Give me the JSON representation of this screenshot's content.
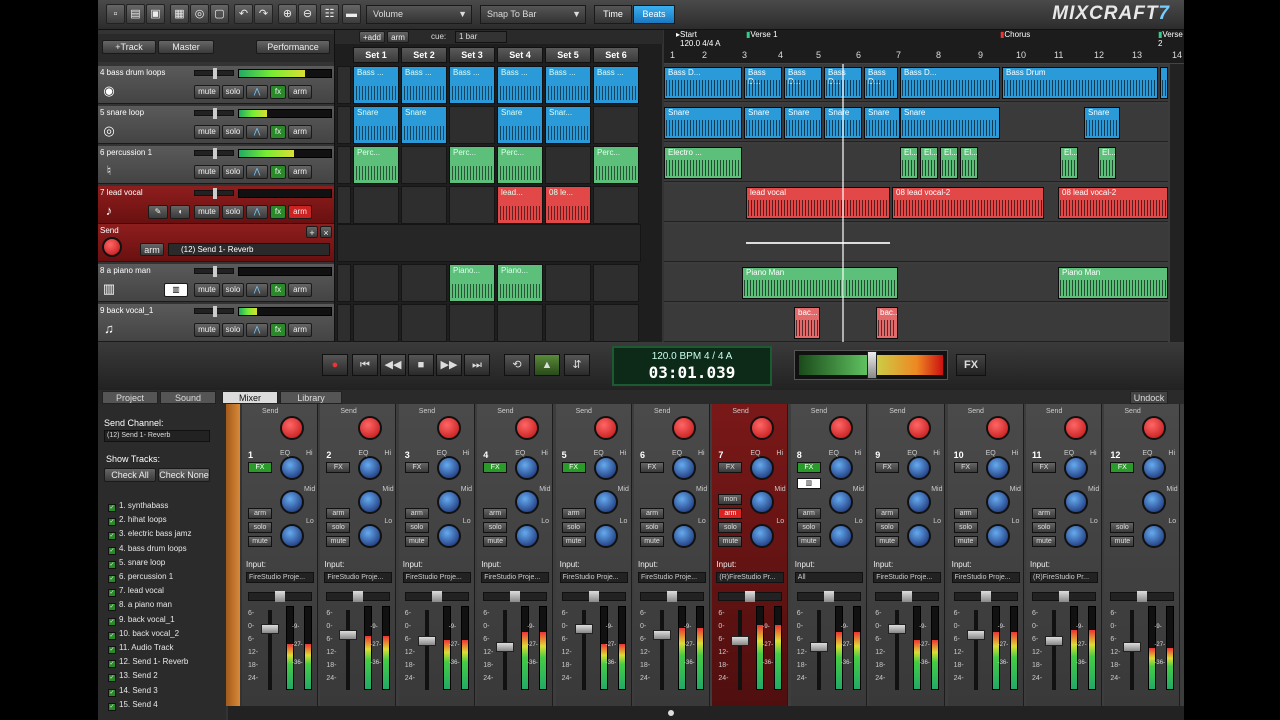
{
  "app": {
    "logo_prefix": "MIXCRAFT",
    "logo_version": "7"
  },
  "toolbar": {
    "volume_dropdown": "Volume",
    "snap_dropdown": "Snap To Bar",
    "time_label": "Time",
    "beats_label": "Beats"
  },
  "track_header": {
    "add_track": "+Track",
    "master": "Master",
    "performance": "Performance"
  },
  "tracks": [
    {
      "name": "4 bass drum loops",
      "icon": "drum-icon",
      "level": 0.72
    },
    {
      "name": "5 snare loop",
      "icon": "snare-icon",
      "level": 0.3
    },
    {
      "name": "6 percussion 1",
      "icon": "percussion-icon",
      "level": 0.6
    },
    {
      "name": "7 lead vocal",
      "icon": "microphone-icon",
      "level": 0.0
    },
    {
      "name": "8 a piano man",
      "icon": "piano-icon",
      "level": 0.0
    },
    {
      "name": "9 back vocal_1",
      "icon": "singer-icon",
      "level": 0.2
    }
  ],
  "track_buttons": {
    "mute": "mute",
    "solo": "solo",
    "fx": "fx",
    "arm": "arm"
  },
  "send": {
    "label": "Send",
    "arm": "arm",
    "channel": "(12) Send 1- Reverb"
  },
  "launcher": {
    "add": "+add",
    "arm": "arm",
    "cue_label": "cue:",
    "cue_value": "1 bar",
    "sets": [
      "Set 1",
      "Set 2",
      "Set 3",
      "Set 4",
      "Set 5",
      "Set 6"
    ],
    "clips": {
      "bass": "Bass ...",
      "snare": "Snare",
      "snare_short": "Snar...",
      "perc": "Perc...",
      "lead": "lead...",
      "lead_cue": "08 le...",
      "piano": "Piano..."
    }
  },
  "timeline": {
    "tempo_marker": "120.0 4/4 A",
    "markers": {
      "start": "Start",
      "verse1": "Verse 1",
      "chorus": "Chorus",
      "verse2": "Verse 2"
    },
    "bars": [
      "1",
      "2",
      "3",
      "4",
      "5",
      "6",
      "7",
      "8",
      "9",
      "10",
      "11",
      "12",
      "13",
      "14"
    ],
    "clip_labels": {
      "bass_drum": "Bass D...",
      "bass_drum_full": "Bass Drum",
      "snare": "Snare",
      "electro": "Electro ...",
      "el": "El...",
      "lead_vocal": "lead vocal",
      "lead_vocal_2": "08 lead vocal-2",
      "piano_man": "Piano Man",
      "back": "bac..."
    }
  },
  "transport": {
    "bpm_sig": "120.0 BPM  4 / 4    A",
    "time": "03:01.039",
    "fx": "FX"
  },
  "bottom_tabs": [
    "Project",
    "Sound",
    "Mixer",
    "Library"
  ],
  "undock": "Undock",
  "send_panel": {
    "title": "Send Channel:",
    "channel": "(12) Send 1- Reverb",
    "show_tracks": "Show Tracks:",
    "check_all": "Check All",
    "check_none": "Check None",
    "tracks": [
      "1. synthabass",
      "2. hihat loops",
      "3. electric bass jamz",
      "4. bass drum loops",
      "5. snare loop",
      "6. percussion 1",
      "7. lead vocal",
      "8. a piano man",
      "9. back vocal_1",
      "10. back vocal_2",
      "11. Audio Track",
      "12. Send 1- Reverb",
      "13. Send 2",
      "14. Send 3",
      "15. Send 4"
    ]
  },
  "mixer": {
    "send_label": "Send",
    "eq_label": "EQ",
    "hi": "Hi",
    "mid": "Mid",
    "lo": "Lo",
    "fx": "FX",
    "arm": "arm",
    "solo": "solo",
    "mute": "mute",
    "mon": "mon",
    "input_label": "Input:",
    "strips": [
      {
        "num": "1",
        "name": "synthabass",
        "input": "FireStudio Proje...",
        "color": "#223344",
        "vu": 0.55
      },
      {
        "num": "2",
        "name": "hihat loops",
        "input": "FireStudio Proje...",
        "color": "#223344",
        "vu": 0.65
      },
      {
        "num": "3",
        "name": "electric bass jamz",
        "input": "FireStudio Proje...",
        "color": "#223344",
        "vu": 0.6
      },
      {
        "num": "4",
        "name": "bass drum loops",
        "input": "FireStudio Proje...",
        "color": "#223344",
        "vu": 0.7
      },
      {
        "num": "5",
        "name": "snare loop",
        "input": "FireStudio Proje...",
        "color": "#223344",
        "vu": 0.55
      },
      {
        "num": "6",
        "name": "percussion 1",
        "input": "FireStudio Proje...",
        "color": "#1e4a3a",
        "vu": 0.75
      },
      {
        "num": "7",
        "name": "lead vocal",
        "input": "(R)FireStudio Pr...",
        "color": "#6a1212",
        "vu": 0.78
      },
      {
        "num": "8",
        "name": "a piano man",
        "input": "All",
        "color": "#1e4a3a",
        "vu": 0.7
      },
      {
        "num": "9",
        "name": "back vocal_1",
        "input": "FireStudio Proje...",
        "color": "#5a1a2a",
        "vu": 0.6
      },
      {
        "num": "10",
        "name": "back vocal_2",
        "input": "FireStudio Proje...",
        "color": "#5a1a2a",
        "vu": 0.7
      },
      {
        "num": "11",
        "name": "Audio Track",
        "input": "(R)FireStudio Pr...",
        "color": "#1e4a2a",
        "vu": 0.72
      },
      {
        "num": "12",
        "name": "Send 1- Reverb",
        "input": "",
        "color": "#2a2a4a",
        "vu": 0.5
      }
    ],
    "scale": [
      "6-",
      "0-",
      "6-",
      "12-",
      "18-",
      "24-"
    ],
    "meter_scale": [
      "-9-",
      "-27-",
      "-36-"
    ]
  },
  "colors": {
    "blue_clip": "#2a9ad8",
    "green_clip": "#5cbf7a",
    "red_clip": "#e24848",
    "accent": "#2a8ad8"
  }
}
